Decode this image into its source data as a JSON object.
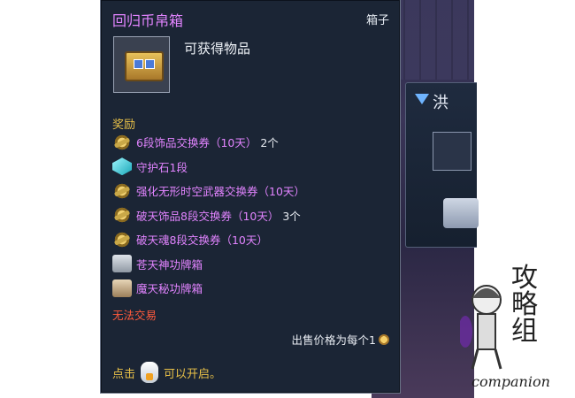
{
  "tooltip": {
    "title": "回归币帛箱",
    "kind": "箱子",
    "obtain_label": "可获得物品",
    "reward_heading": "奖励",
    "rewards": [
      {
        "name": "6段饰品交换券（10天）",
        "qty": "2个",
        "icon": "ticket-icon"
      },
      {
        "name": "守护石1段",
        "qty": "",
        "icon": "gem-icon"
      },
      {
        "name": "强化无形时空武器交换券（10天）",
        "qty": "",
        "icon": "ticket-icon"
      },
      {
        "name": "破天饰品8段交换券（10天）",
        "qty": "3个",
        "icon": "ticket-icon"
      },
      {
        "name": "破天魂8段交换券（10天）",
        "qty": "",
        "icon": "ticket-icon"
      },
      {
        "name": "苍天神功牌箱",
        "qty": "",
        "icon": "silver-box-icon"
      },
      {
        "name": "魔天秘功牌箱",
        "qty": "",
        "icon": "bronze-box-icon"
      }
    ],
    "untradable": "无法交易",
    "price_label": "出售价格为每个1",
    "hint_prefix": "点击",
    "hint_suffix": "可以开启。"
  },
  "side_panel": {
    "title": "洪"
  },
  "watermark": {
    "chars": "攻略组",
    "sub": "companion"
  },
  "colors": {
    "title": "#e284ff",
    "reward_heading": "#e8c048",
    "untradable": "#ff5a3c",
    "panel_bg": "#1b2535"
  }
}
